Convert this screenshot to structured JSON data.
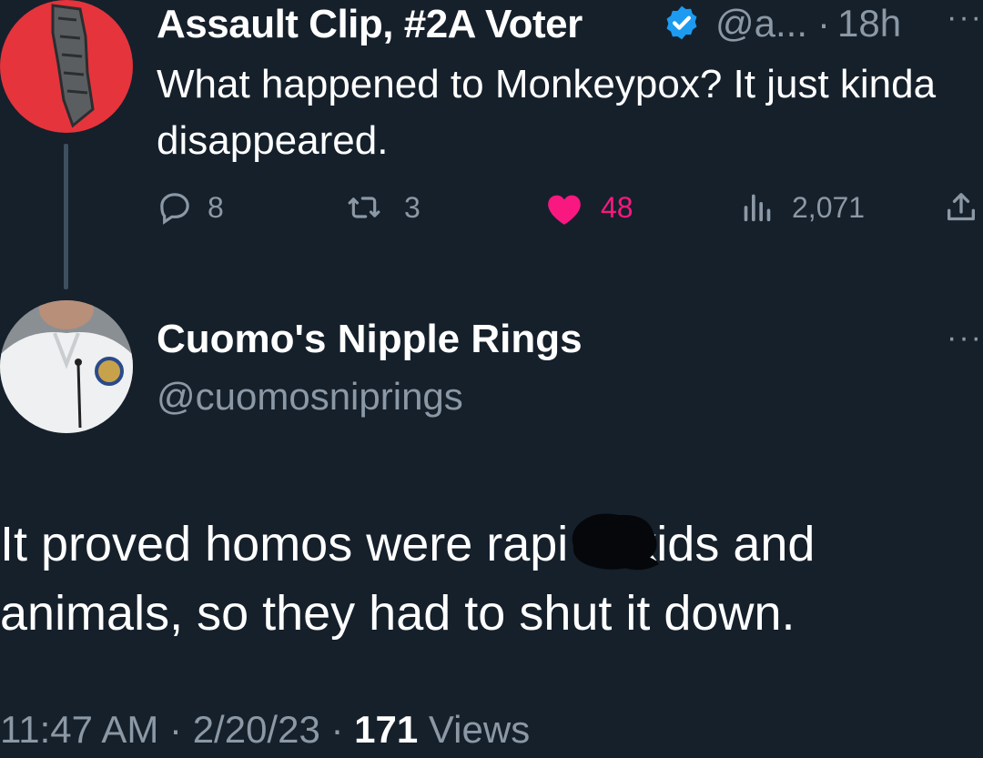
{
  "tweet": {
    "author": "Assault Clip, #2A Voter",
    "handle": "@a...",
    "separator": "·",
    "time": "18h",
    "more": "···",
    "text": "What happened to Monkeypox? It just kinda disappeared.",
    "replies": "8",
    "retweets": "3",
    "likes": "48",
    "views": "2,071"
  },
  "reply": {
    "author": "Cuomo's Nipple Rings",
    "handle": "@cuomosniprings",
    "more": "···",
    "text_line1": "It proved homos were rapi",
    "text_line1_after": "kids and",
    "text_line2": "animals, so they had to shut it down.",
    "time": "11:47 AM",
    "date": "2/20/23",
    "separator": "·",
    "view_count": "171",
    "views_label": "Views"
  },
  "colors": {
    "background": "#15202b",
    "muted": "#8b98a5",
    "like": "#f91880",
    "verified": "#1d9bf0",
    "avatar1_bg": "#e5343c"
  },
  "icons": [
    "reply-icon",
    "retweet-icon",
    "heart-icon",
    "views-icon",
    "share-icon",
    "verified-badge-icon",
    "more-icon"
  ]
}
